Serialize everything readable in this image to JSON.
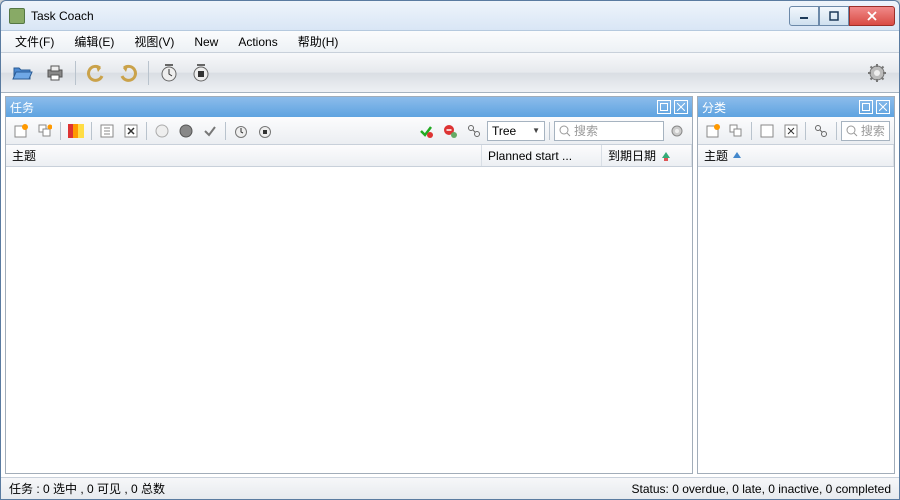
{
  "window": {
    "title": "Task Coach"
  },
  "menu": {
    "file": "文件(F)",
    "edit": "编辑(E)",
    "view": "视图(V)",
    "new": "New",
    "actions": "Actions",
    "help": "帮助(H)"
  },
  "panels": {
    "tasks": {
      "title": "任务",
      "viewmode": "Tree",
      "search_placeholder": "搜索",
      "columns": {
        "subject": "主题",
        "planned": "Planned start ...",
        "due": "到期日期"
      }
    },
    "categories": {
      "title": "分类",
      "search_placeholder": "搜索",
      "columns": {
        "subject": "主题"
      }
    }
  },
  "status": {
    "left": "任务 : 0 选中 , 0 可见 , 0 总数",
    "right": "Status: 0 overdue, 0 late, 0 inactive, 0 completed"
  }
}
